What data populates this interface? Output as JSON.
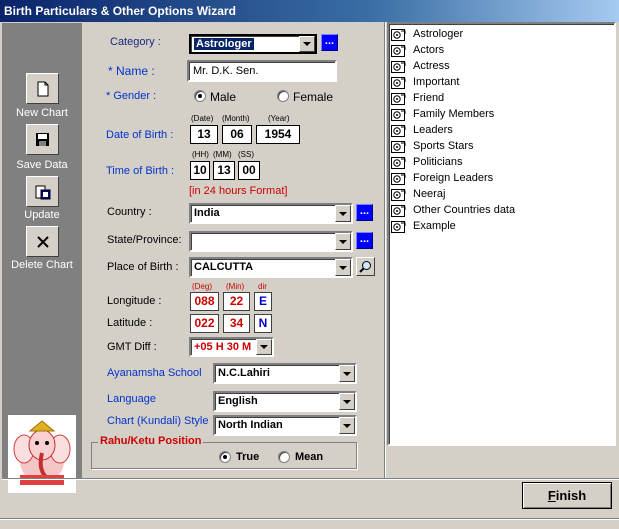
{
  "window": {
    "title": "Birth Particulars & Other Options Wizard"
  },
  "sidebar": {
    "new_chart": "New Chart",
    "save_data": "Save Data",
    "update": "Update",
    "delete_chart": "Delete Chart"
  },
  "form": {
    "category_label": "Category :",
    "category_value": "Astrologer",
    "name_label": "* Name :",
    "name_value": "Mr. D.K. Sen.",
    "gender_label": "* Gender :",
    "gender_male": "Male",
    "gender_female": "Female",
    "gender_selected": "Male",
    "dob_label": "Date of Birth :",
    "dob_hint_date": "(Date)",
    "dob_hint_month": "(Month)",
    "dob_hint_year": "(Year)",
    "dob_date": "13",
    "dob_month": "06",
    "dob_year": "1954",
    "tob_label": "Time of Birth :",
    "tob_hint_hh": "(HH)",
    "tob_hint_mm": "(MM)",
    "tob_hint_ss": "(SS)",
    "tob_hh": "10",
    "tob_mm": "13",
    "tob_ss": "00",
    "tob_format_note": "[in 24 hours Format]",
    "country_label": "Country :",
    "country_value": "India",
    "state_label": "State/Province:",
    "state_value": "",
    "place_label": "Place of Birth :",
    "place_value": "CALCUTTA",
    "coord_hint_deg": "(Deg)",
    "coord_hint_min": "(Min)",
    "coord_hint_dir": "dir",
    "longitude_label": "Longitude :",
    "longitude_deg": "088",
    "longitude_min": "22",
    "longitude_dir": "E",
    "latitude_label": "Latitude :",
    "latitude_deg": "022",
    "latitude_min": "34",
    "latitude_dir": "N",
    "gmt_label": "GMT Diff :",
    "gmt_value": "+05 H 30 M",
    "ayanamsha_label": "Ayanamsha School",
    "ayanamsha_value": "N.C.Lahiri",
    "language_label": "Language",
    "language_value": "English",
    "chart_style_label": "Chart (Kundali) Style",
    "chart_style_value": "North Indian",
    "rahu_ketu_label": "Rahu/Ketu Position",
    "rahu_true": "True",
    "rahu_mean": "Mean",
    "rahu_selected": "True",
    "ellipsis": "..."
  },
  "categories": [
    "Astrologer",
    "Actors",
    "Actress",
    "Important",
    "Friend",
    "Family Members",
    "Leaders",
    "Sports Stars",
    "Politicians",
    "Foreign Leaders",
    "Neeraj",
    "Other Countries data",
    "Example"
  ],
  "footer": {
    "finish_label": "inish",
    "finish_mnemonic": "F"
  },
  "colors": {
    "accent_blue": "#0033cc",
    "value_red": "#cc0000",
    "title_bar": "#0a246a"
  }
}
